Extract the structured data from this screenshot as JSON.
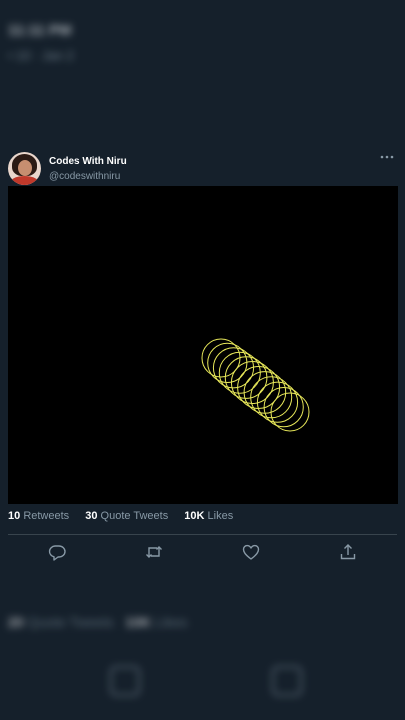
{
  "background_header": {
    "title": "11:11 PM",
    "subtitle": "• 10 · Jan 2"
  },
  "tweet": {
    "author": {
      "display_name": "Codes With Niru",
      "handle": "@codeswithniru"
    },
    "stats": {
      "retweets_count": "10",
      "retweets_label": "Retweets",
      "quote_tweets_count": "30",
      "quote_tweets_label": "Quote Tweets",
      "likes_count": "10K",
      "likes_label": "Likes"
    },
    "media": {
      "background": "#000000",
      "stroke_color": "#e8e85a",
      "rings": 12
    }
  },
  "background_footer": {
    "retweets_count": "20",
    "retweets_label": "Quote Tweets",
    "likes_count": "10K",
    "likes_label": "Likes"
  },
  "colors": {
    "page_bg": "#15202b",
    "muted_text": "#8899a6",
    "divider": "#38444d"
  },
  "icons": {
    "more": "more-horizontal-icon",
    "reply": "reply-icon",
    "retweet": "retweet-icon",
    "like": "like-icon",
    "share": "share-icon"
  }
}
